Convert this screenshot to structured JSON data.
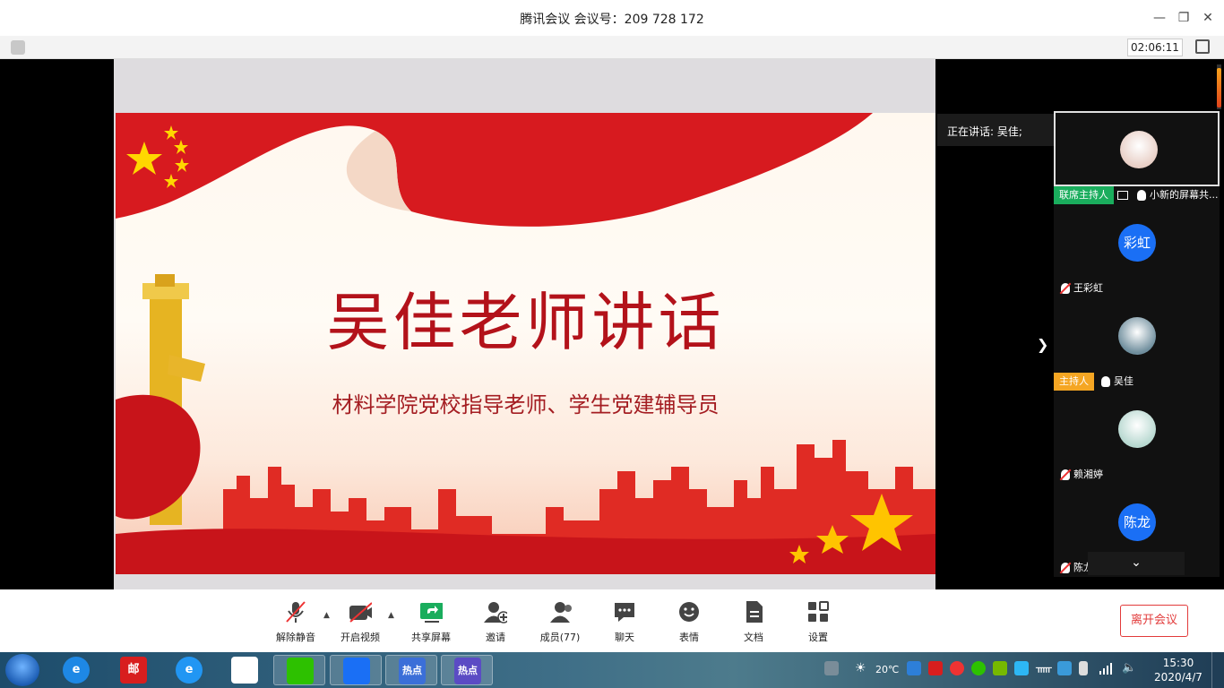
{
  "titlebar": {
    "title": "腾讯会议 会议号：209 728 172"
  },
  "meeting": {
    "timer": "02:06:11"
  },
  "slide": {
    "title": "吴佳老师讲话",
    "subtitle": "材料学院党校指导老师、学生党建辅导员"
  },
  "speaking": {
    "text": "正在讲话: 吴佳;"
  },
  "participants": [
    {
      "role": "联席主持人",
      "role_color": "#1aad5d",
      "name": "小新的屏幕共...",
      "muted": false,
      "sharing": true,
      "avatar": "photo",
      "avatar_color": "#e8cfc6"
    },
    {
      "role": "",
      "name": "王彩虹",
      "muted": true,
      "avatar": "彩虹",
      "avatar_color": "#1a6ff5"
    },
    {
      "role": "主持人",
      "role_color": "#f5a623",
      "name": "吴佳",
      "muted": false,
      "avatar": "photo",
      "avatar_color": "#6f8e9d"
    },
    {
      "role": "",
      "name": "赖湘婷",
      "muted": true,
      "avatar": "photo",
      "avatar_color": "#b7d8d0"
    },
    {
      "role": "",
      "name": "陈龙",
      "muted": true,
      "avatar": "陈龙",
      "avatar_color": "#1a6ff5"
    }
  ],
  "controls": {
    "unmute": "解除静音",
    "start_video": "开启视频",
    "share_screen": "共享屏幕",
    "invite": "邀请",
    "members": "成员(77)",
    "chat": "聊天",
    "reactions": "表情",
    "docs": "文档",
    "settings": "设置",
    "leave": "离开会议"
  },
  "taskbar": {
    "apps": [
      {
        "name": "邮",
        "color": "#d81e1e"
      },
      {
        "name": "e",
        "color": "#1e88e5"
      },
      {
        "name": "e",
        "color": "#2196f3"
      },
      {
        "name": "百度网盘",
        "color": "#4a90e2"
      },
      {
        "name": "微信",
        "color": "#2dc100"
      },
      {
        "name": "腾讯会议",
        "color": "#1a6ff5"
      },
      {
        "name": "热点",
        "color": "#3b6fd8"
      },
      {
        "name": "热点",
        "color": "#5b4bc4"
      }
    ],
    "labels": {
      "hot1": "热点",
      "hot2": "热点",
      "mail": "邮"
    },
    "weather": "20℃",
    "time": "15:30",
    "date": "2020/4/7"
  },
  "colors": {
    "accent": "#1a6ff5",
    "leave": "#e23b3b",
    "slide_red": "#b3121a"
  }
}
